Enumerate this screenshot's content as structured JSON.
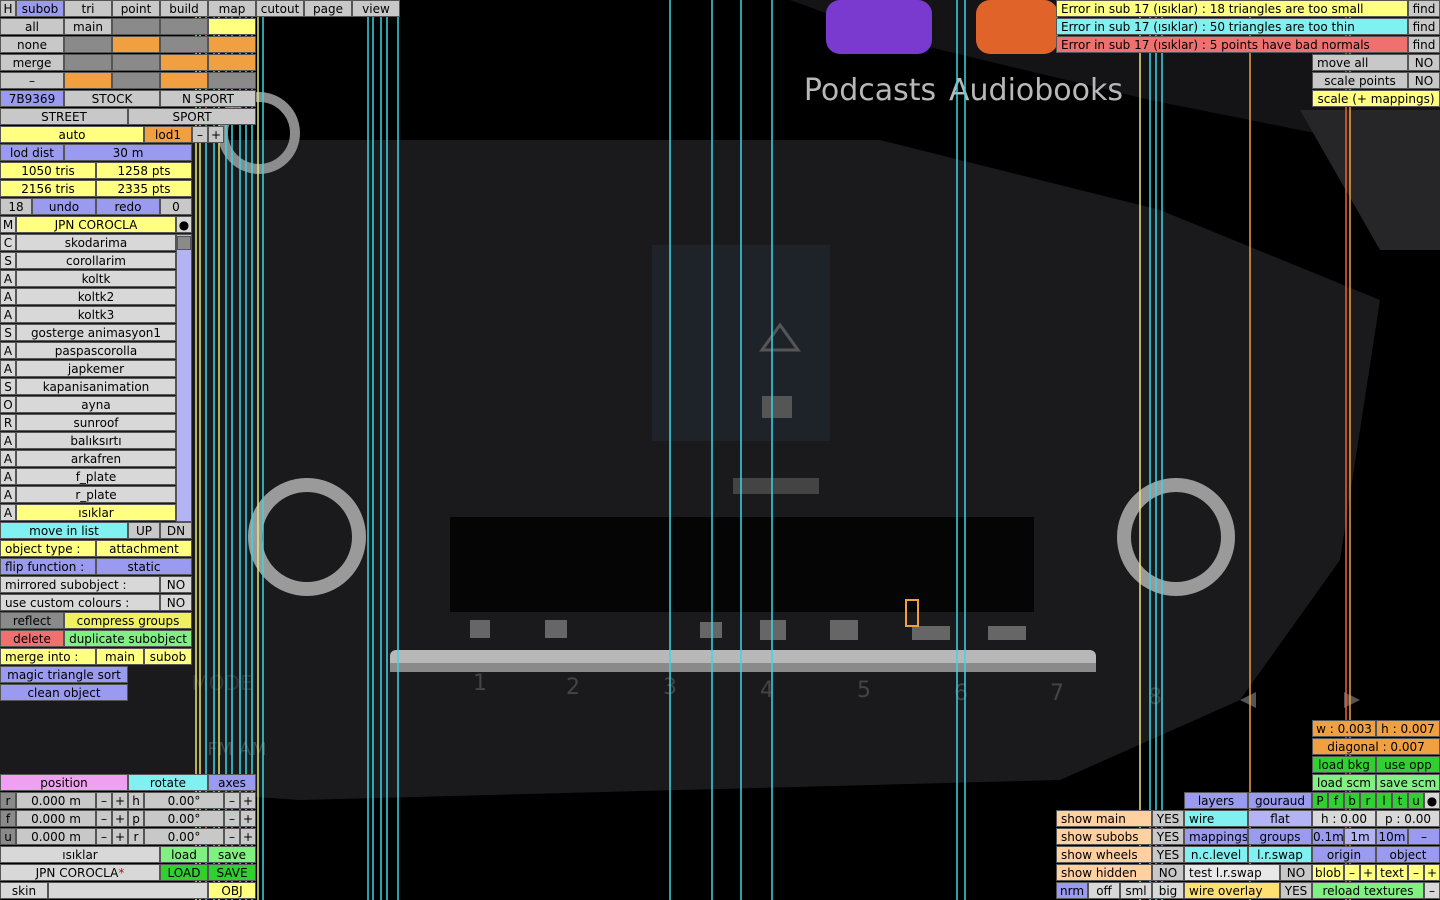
{
  "menu": {
    "tabs": [
      "H",
      "subob",
      "tri",
      "point",
      "build",
      "map",
      "cutout",
      "page",
      "view"
    ]
  },
  "select": {
    "rows": [
      "all",
      "none",
      "merge",
      "–"
    ],
    "main": "main"
  },
  "info": {
    "id": "7B9369",
    "stock": "STOCK",
    "nsport": "N SPORT",
    "street": "STREET",
    "sport": "SPORT",
    "auto": "auto",
    "lod": "lod1",
    "minus": "–",
    "plus": "+",
    "lod_dist_label": "lod dist",
    "lod_dist": "30 m",
    "tris1": "1050 tris",
    "pts1": "1258 pts",
    "tris2": "2156 tris",
    "pts2": "2335 pts",
    "count": "18",
    "undo": "undo",
    "redo": "redo",
    "zero": "0"
  },
  "subobjects": {
    "header_type": "M",
    "header_name": "JPN COROCLA",
    "header_dot": "●",
    "items": [
      {
        "t": "C",
        "n": "skodarima"
      },
      {
        "t": "S",
        "n": "corollarim"
      },
      {
        "t": "A",
        "n": "koltk"
      },
      {
        "t": "A",
        "n": "koltk2"
      },
      {
        "t": "A",
        "n": "koltk3"
      },
      {
        "t": "S",
        "n": "gosterge animasyon1"
      },
      {
        "t": "A",
        "n": "paspascorolla"
      },
      {
        "t": "A",
        "n": "japkemer"
      },
      {
        "t": "S",
        "n": "kapanisanimation"
      },
      {
        "t": "O",
        "n": "ayna"
      },
      {
        "t": "R",
        "n": "sunroof"
      },
      {
        "t": "A",
        "n": "balıksırtı"
      },
      {
        "t": "A",
        "n": "arkafren"
      },
      {
        "t": "A",
        "n": "f_plate"
      },
      {
        "t": "A",
        "n": "r_plate"
      },
      {
        "t": "A",
        "n": "ısıklar"
      }
    ]
  },
  "props": {
    "move_in_list": "move in list",
    "up": "UP",
    "dn": "DN",
    "object_type": "object type :",
    "attachment": "attachment",
    "flip_function": "flip function :",
    "static": "static",
    "mirrored": "mirrored subobject :",
    "no": "NO",
    "custom_colours": "use custom colours :",
    "reflect": "reflect",
    "compress": "compress groups",
    "delete": "delete",
    "duplicate": "duplicate subobject",
    "merge_into": "merge into :",
    "main": "main",
    "subob": "subob",
    "magic": "magic triangle sort",
    "clean": "clean object"
  },
  "transform": {
    "position": "position",
    "rotate": "rotate",
    "axes": "axes",
    "rows": [
      {
        "a": "r",
        "v": "0.000 m",
        "b": "h",
        "r": "0.00°"
      },
      {
        "a": "f",
        "v": "0.000 m",
        "b": "p",
        "r": "0.00°"
      },
      {
        "a": "u",
        "v": "0.000 m",
        "b": "r",
        "r": "0.00°"
      }
    ],
    "minus": "–",
    "plus": "+",
    "sub_name": "ısıklar",
    "load": "load",
    "save": "save",
    "obj_name": "JPN COROCLA",
    "star": "*",
    "LOAD": "LOAD",
    "SAVE": "SAVE",
    "skin": "skin",
    "OBJ": "OBJ"
  },
  "errors": [
    {
      "text": "Error in sub 17 (ısıklar) : 18 triangles are too small",
      "color": "#ffff80"
    },
    {
      "text": "Error in sub 17 (ısıklar) : 50 triangles are too thin",
      "color": "#80f0f0"
    },
    {
      "text": "Error in sub 17 (ısıklar) : 5 points have bad normals",
      "color": "#f07070"
    }
  ],
  "find": "find",
  "right_top": {
    "move_all": "move all",
    "scale_points": "scale points",
    "scale_map": "scale (+ mappings)",
    "no": "NO"
  },
  "right_bot": {
    "w": "w : 0.003",
    "h": "h : 0.007",
    "diagonal": "diagonal : 0.007",
    "load_bkg": "load bkg",
    "use_opp": "use opp",
    "load_scm": "load scm",
    "save_scm": "save scm",
    "letters": [
      "P",
      "f",
      "b",
      "r",
      "l",
      "t",
      "u",
      "●"
    ],
    "h0": "h : 0.00",
    "p0": "p : 0.00",
    "s1": "0.1m",
    "s2": "1m",
    "s3": "10m",
    "minus": "–",
    "origin": "origin",
    "object": "object",
    "blob": "blob",
    "plus": "+",
    "text": "text",
    "reload": "reload textures"
  },
  "view_opts": {
    "rows": [
      {
        "l": "show main",
        "v": "YES"
      },
      {
        "l": "show subobs",
        "v": "YES"
      },
      {
        "l": "show wheels",
        "v": "YES"
      },
      {
        "l": "show hidden",
        "v": "NO"
      }
    ],
    "nrm": "nrm",
    "off": "off",
    "sml": "sml",
    "big": "big"
  },
  "render_opts": {
    "layers": "layers",
    "gouraud": "gouraud",
    "wire": "wire",
    "flat": "flat",
    "mappings": "mappings",
    "groups": "groups",
    "nclevel": "n.c.level",
    "lrswap": "l.r.swap",
    "test": "test l.r.swap",
    "no": "NO",
    "overlay": "wire overlay",
    "yes": "YES"
  },
  "viewport": {
    "app1": "Podcasts",
    "app2": "Audiobooks",
    "mode": "MODE",
    "fmam": "FM AM",
    "nums": [
      "1",
      "2",
      "3",
      "4",
      "5",
      "6",
      "7",
      "8"
    ]
  }
}
